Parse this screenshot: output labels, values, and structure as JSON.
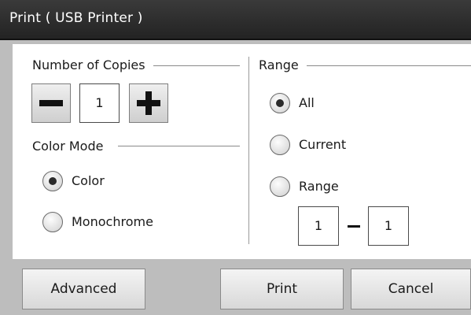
{
  "window": {
    "title": "Print ( USB Printer )"
  },
  "copies": {
    "label": "Number of Copies",
    "value": "1",
    "decrement_icon": "minus-icon",
    "increment_icon": "plus-icon"
  },
  "color_mode": {
    "label": "Color Mode",
    "options": [
      {
        "label": "Color",
        "checked": true
      },
      {
        "label": "Monochrome",
        "checked": false
      }
    ]
  },
  "range": {
    "label": "Range",
    "options": [
      {
        "label": "All",
        "checked": true
      },
      {
        "label": "Current",
        "checked": false
      },
      {
        "label": "Range",
        "checked": false
      }
    ],
    "from": "1",
    "to": "1"
  },
  "buttons": {
    "advanced": "Advanced",
    "print": "Print",
    "cancel": "Cancel"
  }
}
